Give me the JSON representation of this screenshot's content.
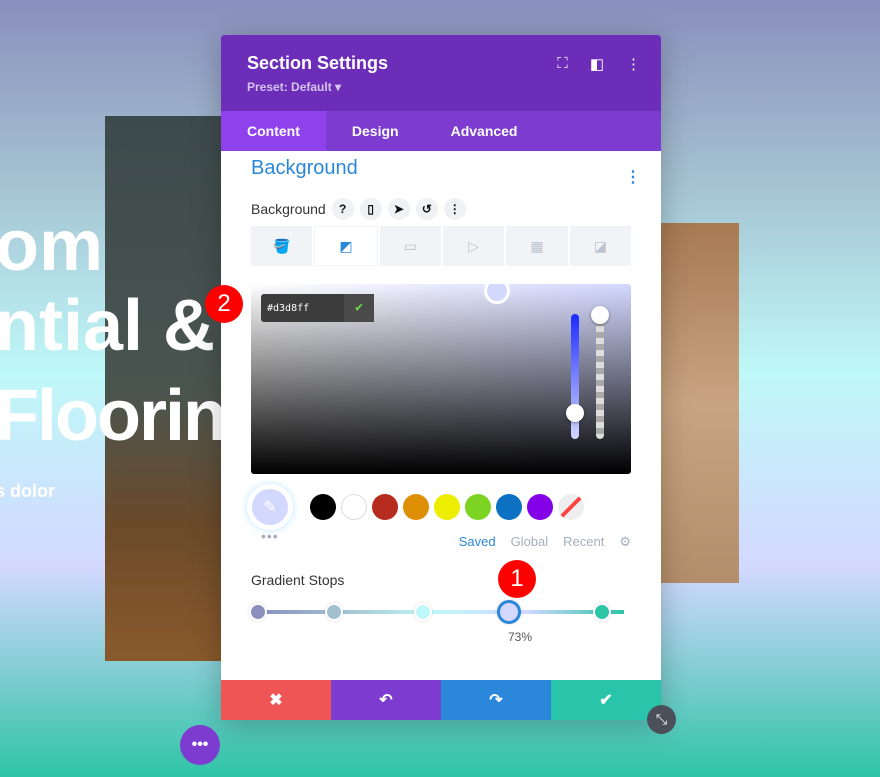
{
  "background_page": {
    "line1": "om",
    "line2": "ntial &",
    "line3": "Flooring",
    "line4": "s dolor"
  },
  "panel": {
    "title": "Section Settings",
    "preset": "Preset: Default ▾",
    "tabs": [
      {
        "label": "Content"
      },
      {
        "label": "Design"
      },
      {
        "label": "Advanced"
      }
    ],
    "section_title": "Background",
    "bg_label": "Background",
    "bg_icons": [
      "help-icon",
      "mobile-icon",
      "hover-cursor-icon",
      "reset-icon",
      "more-icon"
    ],
    "bg_types": [
      "color",
      "gradient",
      "image",
      "video",
      "pattern",
      "mask"
    ],
    "active_type": "gradient",
    "picker": {
      "hex": "#d3d8ff",
      "selected_color": "#d3d8ff"
    },
    "swatches": [
      "#000000",
      "#ffffff",
      "#b72c1f",
      "#de8f06",
      "#eded00",
      "#7cd321",
      "#0c71c3",
      "#8300e9",
      "transparent"
    ],
    "palette_tabs": {
      "saved": "Saved",
      "global": "Global",
      "recent": "Recent"
    },
    "gradient_stops_label": "Gradient Stops",
    "stops": [
      {
        "color": "#8a8fbd",
        "pos": 0
      },
      {
        "color": "#a3bfd0",
        "pos": 22
      },
      {
        "color": "#bff8f8",
        "pos": 48
      },
      {
        "color": "#d3d8ff",
        "pos": 73
      },
      {
        "color": "#2ec4a6",
        "pos": 100
      }
    ],
    "selected_stop_label": "73%",
    "footer": {
      "cancel": "✖",
      "undo": "↶",
      "redo": "↷",
      "save": "✔"
    }
  },
  "badges": {
    "one": "1",
    "two": "2"
  },
  "fab": "•••"
}
